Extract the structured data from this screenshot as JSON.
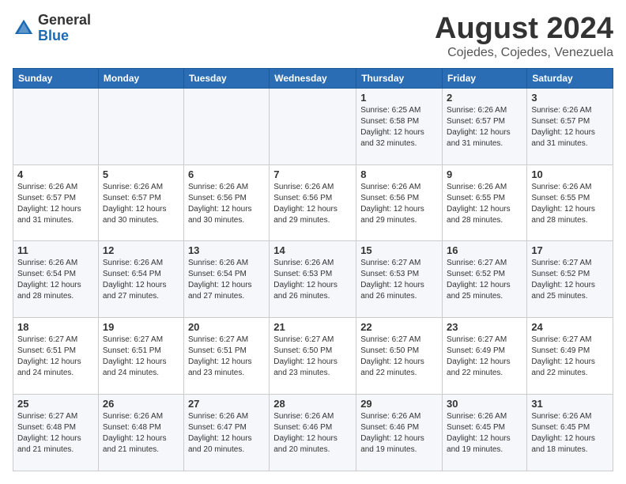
{
  "logo": {
    "general": "General",
    "blue": "Blue"
  },
  "title": "August 2024",
  "subtitle": "Cojedes, Cojedes, Venezuela",
  "days_header": [
    "Sunday",
    "Monday",
    "Tuesday",
    "Wednesday",
    "Thursday",
    "Friday",
    "Saturday"
  ],
  "weeks": [
    [
      {
        "day": "",
        "info": ""
      },
      {
        "day": "",
        "info": ""
      },
      {
        "day": "",
        "info": ""
      },
      {
        "day": "",
        "info": ""
      },
      {
        "day": "1",
        "info": "Sunrise: 6:25 AM\nSunset: 6:58 PM\nDaylight: 12 hours and 32 minutes."
      },
      {
        "day": "2",
        "info": "Sunrise: 6:26 AM\nSunset: 6:57 PM\nDaylight: 12 hours and 31 minutes."
      },
      {
        "day": "3",
        "info": "Sunrise: 6:26 AM\nSunset: 6:57 PM\nDaylight: 12 hours and 31 minutes."
      }
    ],
    [
      {
        "day": "4",
        "info": "Sunrise: 6:26 AM\nSunset: 6:57 PM\nDaylight: 12 hours and 31 minutes."
      },
      {
        "day": "5",
        "info": "Sunrise: 6:26 AM\nSunset: 6:57 PM\nDaylight: 12 hours and 30 minutes."
      },
      {
        "day": "6",
        "info": "Sunrise: 6:26 AM\nSunset: 6:56 PM\nDaylight: 12 hours and 30 minutes."
      },
      {
        "day": "7",
        "info": "Sunrise: 6:26 AM\nSunset: 6:56 PM\nDaylight: 12 hours and 29 minutes."
      },
      {
        "day": "8",
        "info": "Sunrise: 6:26 AM\nSunset: 6:56 PM\nDaylight: 12 hours and 29 minutes."
      },
      {
        "day": "9",
        "info": "Sunrise: 6:26 AM\nSunset: 6:55 PM\nDaylight: 12 hours and 28 minutes."
      },
      {
        "day": "10",
        "info": "Sunrise: 6:26 AM\nSunset: 6:55 PM\nDaylight: 12 hours and 28 minutes."
      }
    ],
    [
      {
        "day": "11",
        "info": "Sunrise: 6:26 AM\nSunset: 6:54 PM\nDaylight: 12 hours and 28 minutes."
      },
      {
        "day": "12",
        "info": "Sunrise: 6:26 AM\nSunset: 6:54 PM\nDaylight: 12 hours and 27 minutes."
      },
      {
        "day": "13",
        "info": "Sunrise: 6:26 AM\nSunset: 6:54 PM\nDaylight: 12 hours and 27 minutes."
      },
      {
        "day": "14",
        "info": "Sunrise: 6:26 AM\nSunset: 6:53 PM\nDaylight: 12 hours and 26 minutes."
      },
      {
        "day": "15",
        "info": "Sunrise: 6:27 AM\nSunset: 6:53 PM\nDaylight: 12 hours and 26 minutes."
      },
      {
        "day": "16",
        "info": "Sunrise: 6:27 AM\nSunset: 6:52 PM\nDaylight: 12 hours and 25 minutes."
      },
      {
        "day": "17",
        "info": "Sunrise: 6:27 AM\nSunset: 6:52 PM\nDaylight: 12 hours and 25 minutes."
      }
    ],
    [
      {
        "day": "18",
        "info": "Sunrise: 6:27 AM\nSunset: 6:51 PM\nDaylight: 12 hours and 24 minutes."
      },
      {
        "day": "19",
        "info": "Sunrise: 6:27 AM\nSunset: 6:51 PM\nDaylight: 12 hours and 24 minutes."
      },
      {
        "day": "20",
        "info": "Sunrise: 6:27 AM\nSunset: 6:51 PM\nDaylight: 12 hours and 23 minutes."
      },
      {
        "day": "21",
        "info": "Sunrise: 6:27 AM\nSunset: 6:50 PM\nDaylight: 12 hours and 23 minutes."
      },
      {
        "day": "22",
        "info": "Sunrise: 6:27 AM\nSunset: 6:50 PM\nDaylight: 12 hours and 22 minutes."
      },
      {
        "day": "23",
        "info": "Sunrise: 6:27 AM\nSunset: 6:49 PM\nDaylight: 12 hours and 22 minutes."
      },
      {
        "day": "24",
        "info": "Sunrise: 6:27 AM\nSunset: 6:49 PM\nDaylight: 12 hours and 22 minutes."
      }
    ],
    [
      {
        "day": "25",
        "info": "Sunrise: 6:27 AM\nSunset: 6:48 PM\nDaylight: 12 hours and 21 minutes."
      },
      {
        "day": "26",
        "info": "Sunrise: 6:26 AM\nSunset: 6:48 PM\nDaylight: 12 hours and 21 minutes."
      },
      {
        "day": "27",
        "info": "Sunrise: 6:26 AM\nSunset: 6:47 PM\nDaylight: 12 hours and 20 minutes."
      },
      {
        "day": "28",
        "info": "Sunrise: 6:26 AM\nSunset: 6:46 PM\nDaylight: 12 hours and 20 minutes."
      },
      {
        "day": "29",
        "info": "Sunrise: 6:26 AM\nSunset: 6:46 PM\nDaylight: 12 hours and 19 minutes."
      },
      {
        "day": "30",
        "info": "Sunrise: 6:26 AM\nSunset: 6:45 PM\nDaylight: 12 hours and 19 minutes."
      },
      {
        "day": "31",
        "info": "Sunrise: 6:26 AM\nSunset: 6:45 PM\nDaylight: 12 hours and 18 minutes."
      }
    ]
  ]
}
